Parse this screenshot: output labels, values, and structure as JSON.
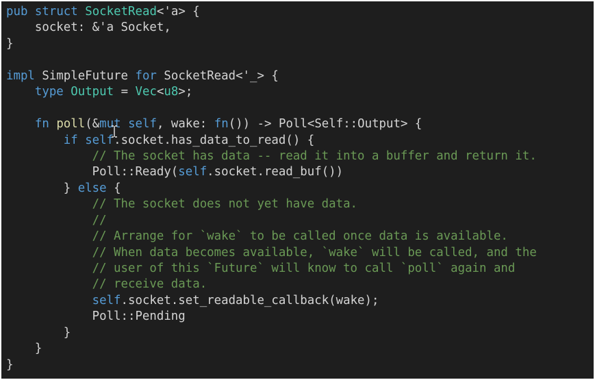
{
  "editor": {
    "language": "rust",
    "theme": {
      "background": "#1e1e1e",
      "keyword": "#569cd6",
      "type": "#4ec9b0",
      "function": "#dcdcaa",
      "variable": "#9cdcfe",
      "comment": "#6a9955",
      "text": "#d4d4d4"
    },
    "lines": [
      [
        {
          "c": "kw",
          "t": "pub"
        },
        {
          "c": "pl",
          "t": " "
        },
        {
          "c": "kw",
          "t": "struct"
        },
        {
          "c": "pl",
          "t": " "
        },
        {
          "c": "ty",
          "t": "SocketRead"
        },
        {
          "c": "pl",
          "t": "<'a> {"
        }
      ],
      [
        {
          "c": "pl",
          "t": "    socket: &'a Socket,"
        }
      ],
      [
        {
          "c": "pl",
          "t": "}"
        }
      ],
      [],
      [
        {
          "c": "kw",
          "t": "impl"
        },
        {
          "c": "pl",
          "t": " SimpleFuture "
        },
        {
          "c": "kw",
          "t": "for"
        },
        {
          "c": "pl",
          "t": " SocketRead<'_> {"
        }
      ],
      [
        {
          "c": "pl",
          "t": "    "
        },
        {
          "c": "kw",
          "t": "type"
        },
        {
          "c": "pl",
          "t": " "
        },
        {
          "c": "ty",
          "t": "Output"
        },
        {
          "c": "pl",
          "t": " = "
        },
        {
          "c": "ty",
          "t": "Vec"
        },
        {
          "c": "pl",
          "t": "<"
        },
        {
          "c": "ty",
          "t": "u8"
        },
        {
          "c": "pl",
          "t": ">;"
        }
      ],
      [],
      [
        {
          "c": "pl",
          "t": "    "
        },
        {
          "c": "kw",
          "t": "fn"
        },
        {
          "c": "pl",
          "t": " "
        },
        {
          "c": "fn",
          "t": "poll"
        },
        {
          "c": "pl",
          "t": "(&"
        },
        {
          "c": "kw",
          "t": "mut"
        },
        {
          "c": "pl",
          "t": " "
        },
        {
          "c": "kw",
          "t": "self"
        },
        {
          "c": "pl",
          "t": ", wake: "
        },
        {
          "c": "kw",
          "t": "fn"
        },
        {
          "c": "pl",
          "t": "()) -> Poll<Self::Output> {"
        }
      ],
      [
        {
          "c": "pl",
          "t": "        "
        },
        {
          "c": "kw",
          "t": "if"
        },
        {
          "c": "pl",
          "t": " "
        },
        {
          "c": "kw",
          "t": "self"
        },
        {
          "c": "pl",
          "t": ".socket.has_data_to_read() {"
        }
      ],
      [
        {
          "c": "pl",
          "t": "            "
        },
        {
          "c": "cm",
          "t": "// The socket has data -- read it into a buffer and return it."
        }
      ],
      [
        {
          "c": "pl",
          "t": "            Poll::Ready("
        },
        {
          "c": "kw",
          "t": "self"
        },
        {
          "c": "pl",
          "t": ".socket.read_buf())"
        }
      ],
      [
        {
          "c": "pl",
          "t": "        } "
        },
        {
          "c": "kw",
          "t": "else"
        },
        {
          "c": "pl",
          "t": " {"
        }
      ],
      [
        {
          "c": "pl",
          "t": "            "
        },
        {
          "c": "cm",
          "t": "// The socket does not yet have data."
        }
      ],
      [
        {
          "c": "pl",
          "t": "            "
        },
        {
          "c": "cm",
          "t": "//"
        }
      ],
      [
        {
          "c": "pl",
          "t": "            "
        },
        {
          "c": "cm",
          "t": "// Arrange for `wake` to be called once data is available."
        }
      ],
      [
        {
          "c": "pl",
          "t": "            "
        },
        {
          "c": "cm",
          "t": "// When data becomes available, `wake` will be called, and the"
        }
      ],
      [
        {
          "c": "pl",
          "t": "            "
        },
        {
          "c": "cm",
          "t": "// user of this `Future` will know to call `poll` again and"
        }
      ],
      [
        {
          "c": "pl",
          "t": "            "
        },
        {
          "c": "cm",
          "t": "// receive data."
        }
      ],
      [
        {
          "c": "pl",
          "t": "            "
        },
        {
          "c": "kw",
          "t": "self"
        },
        {
          "c": "pl",
          "t": ".socket.set_readable_callback(wake);"
        }
      ],
      [
        {
          "c": "pl",
          "t": "            Poll::Pending"
        }
      ],
      [
        {
          "c": "pl",
          "t": "        }"
        }
      ],
      [
        {
          "c": "pl",
          "t": "    }"
        }
      ],
      [
        {
          "c": "pl",
          "t": "}"
        }
      ]
    ]
  },
  "cursor": {
    "icon": "text-cursor-icon"
  }
}
